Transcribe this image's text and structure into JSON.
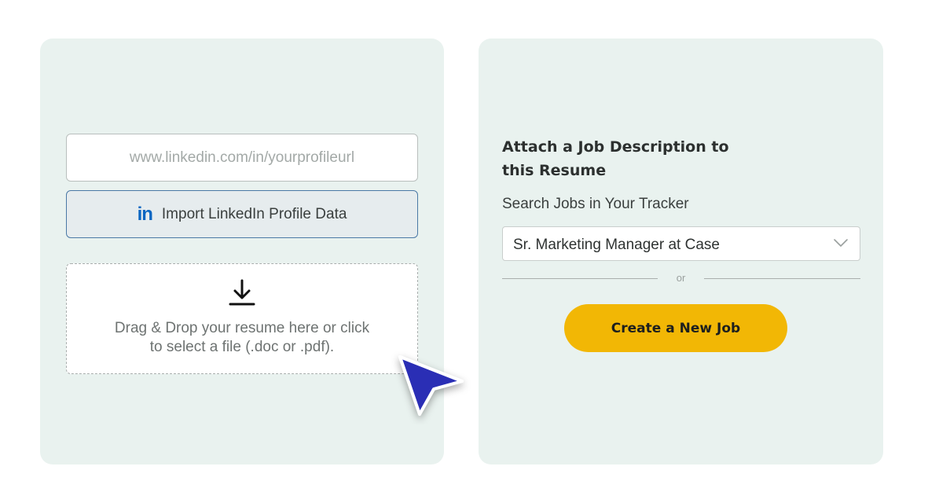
{
  "linkedin": {
    "url_placeholder": "www.linkedin.com/in/yourprofileurl",
    "url_value": "",
    "logo_text": "in",
    "import_label": "Import LinkedIn Profile Data"
  },
  "upload": {
    "icon": "download-icon",
    "line1": "Drag & Drop your resume here or click",
    "line2": "to select a file (.doc or .pdf)."
  },
  "job": {
    "title_line1": "Attach a Job Description to",
    "title_line2": "this Resume",
    "search_label": "Search Jobs in Your Tracker",
    "selected_job": "Sr. Marketing Manager at Case",
    "divider_text": "or",
    "create_label": "Create a New Job"
  },
  "colors": {
    "panel_bg": "#e9f2ef",
    "linkedin_blue": "#0a66c2",
    "accent_yellow": "#f2b705",
    "cursor_blue": "#2a2fb5"
  }
}
